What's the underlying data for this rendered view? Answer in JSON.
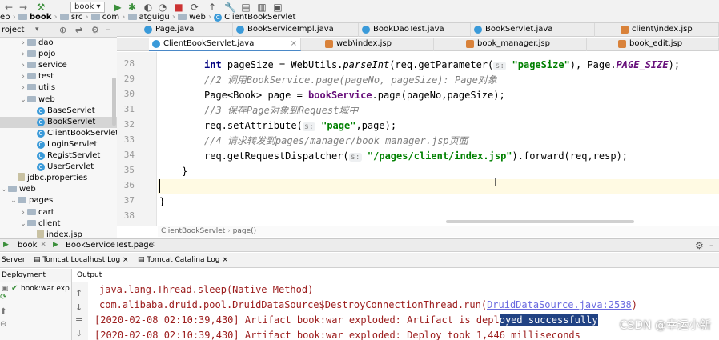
{
  "toolbar": {
    "breadcrumbs": [
      "eb",
      "book",
      "src",
      "com",
      "atguigu",
      "web",
      "ClientBookServlet"
    ],
    "run_config": "book"
  },
  "project": {
    "title": "roject",
    "tree": [
      {
        "label": "dao",
        "type": "folder",
        "indent": 1,
        "expanded": false
      },
      {
        "label": "pojo",
        "type": "folder",
        "indent": 1,
        "expanded": false
      },
      {
        "label": "service",
        "type": "folder",
        "indent": 1,
        "expanded": false
      },
      {
        "label": "test",
        "type": "folder",
        "indent": 1,
        "expanded": false
      },
      {
        "label": "utils",
        "type": "folder",
        "indent": 1,
        "expanded": false
      },
      {
        "label": "web",
        "type": "folder",
        "indent": 1,
        "expanded": true
      },
      {
        "label": "BaseServlet",
        "type": "class",
        "indent": 2
      },
      {
        "label": "BookServlet",
        "type": "class",
        "indent": 2,
        "selected": true
      },
      {
        "label": "ClientBookServlet",
        "type": "class",
        "indent": 2
      },
      {
        "label": "LoginServlet",
        "type": "class",
        "indent": 2
      },
      {
        "label": "RegistServlet",
        "type": "class",
        "indent": 2
      },
      {
        "label": "UserServlet",
        "type": "class",
        "indent": 2
      },
      {
        "label": "jdbc.properties",
        "type": "file",
        "indent": 0
      },
      {
        "label": "web",
        "type": "folder",
        "indent": -1,
        "expanded": true
      },
      {
        "label": "pages",
        "type": "folder",
        "indent": 0,
        "expanded": true
      },
      {
        "label": "cart",
        "type": "folder",
        "indent": 1,
        "expanded": false
      },
      {
        "label": "client",
        "type": "folder",
        "indent": 1,
        "expanded": true
      },
      {
        "label": "index.jsp",
        "type": "file",
        "indent": 2
      }
    ]
  },
  "tabs_row1": [
    "Page.java",
    "BookServiceImpl.java",
    "BookDaoTest.java",
    "BookServlet.java",
    "client\\index.jsp"
  ],
  "tabs_row2": [
    "ClientBookServlet.java",
    "web\\index.jsp",
    "book_manager.jsp",
    "book_edit.jsp"
  ],
  "editor": {
    "line_numbers": [
      "28",
      "29",
      "30",
      "31",
      "32",
      "33",
      "34",
      "35",
      "36",
      "37",
      "38"
    ],
    "lines": [
      {
        "n": "int",
        "a": " pageSize = WebUtils.",
        "b": "parseInt",
        "c": "(req.getParameter(",
        "h": "s:",
        "s": "\"pageSize\"",
        "d": "), Page.",
        "e": "PAGE_SIZE",
        "f": ");"
      },
      {
        "comment": "//2 调用BookService.page(pageNo, pageSize): Page对象"
      },
      {
        "plain1": "Page<Book> page = ",
        "bold": "bookService",
        "plain2": ".page(pageNo,pageSize);"
      },
      {
        "comment": "//3 保存Page对象到Request域中"
      },
      {
        "plain1": "req.setAttribute(",
        "h": "s:",
        "s": "\"page\"",
        "plain2": ",page);"
      },
      {
        "comment": "//4 请求转发到pages/manager/book_manager.jsp页面"
      },
      {
        "plain1": "req.getRequestDispatcher(",
        "h": "s:",
        "s": "\"/pages/client/index.jsp\"",
        "plain2": ").forward(req,resp);"
      },
      {
        "plain1": "}"
      },
      {
        "plain1": ""
      },
      {
        "plain1": "}"
      },
      {
        "plain1": ""
      }
    ]
  },
  "breadcrumb": {
    "class": "ClientBookServlet",
    "method": "page()"
  },
  "runbar": {
    "run1": "book",
    "run2": "BookServiceTest.page"
  },
  "subtabs": {
    "server": "Server",
    "log1": "Tomcat Localhost Log",
    "log2": "Tomcat Catalina Log"
  },
  "deployment": {
    "header": "Deployment",
    "item": "book:war exp"
  },
  "output": {
    "header": "Output",
    "line1": "java.lang.Thread.sleep(Native Method)",
    "line2a": "com.alibaba.druid.pool.DruidDataSource$DestroyConnectionThread.run(",
    "line2link": "DruidDataSource.java:2538",
    "line2b": ")",
    "line3a": "[2020-02-08 02:10:39,430] Artifact book:war exploded: Artifact is depl",
    "line3sel": "oyed successfully",
    "line4": "[2020-02-08 02:10:39,430] Artifact book:war exploded: Deploy took 1,446 milliseconds"
  },
  "watermark": "CSDN @幸运小新"
}
